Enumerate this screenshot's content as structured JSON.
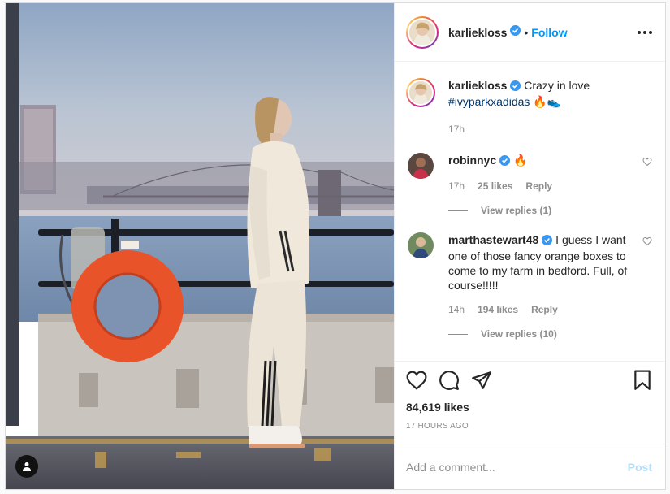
{
  "header": {
    "username": "karliekloss",
    "dot": "•",
    "follow_label": "Follow",
    "verified_icon": "verified-badge-icon",
    "more_icon": "more-options-icon"
  },
  "caption": {
    "username": "karliekloss",
    "text": "Crazy in love",
    "hashtag": "#ivyparkxadidas",
    "emoji": "🔥👟",
    "time": "17h"
  },
  "comments": [
    {
      "username": "robinnyc",
      "text": "🔥",
      "time": "17h",
      "likes": "25 likes",
      "reply": "Reply",
      "view_replies": "View replies (1)"
    },
    {
      "username": "marthastewart48",
      "text": "I guess I want one of those fancy orange boxes to come to my farm in bedford. Full, of course!!!!!",
      "time": "14h",
      "likes": "194 likes",
      "reply": "Reply",
      "view_replies": "View replies (10)"
    }
  ],
  "actions": {
    "icons": [
      "heart-icon",
      "comment-icon",
      "share-icon",
      "bookmark-icon"
    ],
    "likes": "84,619 likes",
    "time_ago": "17 HOURS AGO"
  },
  "add_comment": {
    "placeholder": "Add a comment...",
    "post_label": "Post"
  },
  "colors": {
    "link_blue": "#0095f6",
    "post_disabled": "#b2dffc",
    "secondary_text": "#8e8e8e",
    "hashtag": "#00376b",
    "life_ring": "#e8532a"
  }
}
